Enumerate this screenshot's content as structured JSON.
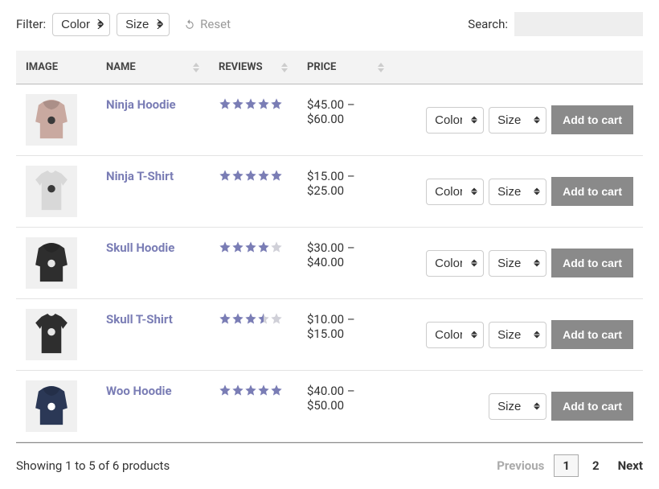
{
  "filter": {
    "label": "Filter:",
    "selects": [
      {
        "id": "color",
        "label": "Color"
      },
      {
        "id": "size",
        "label": "Size"
      }
    ],
    "reset": "Reset"
  },
  "search": {
    "label": "Search:"
  },
  "table": {
    "headers": {
      "image": "IMAGE",
      "name": "NAME",
      "reviews": "REVIEWS",
      "price": "PRICE"
    },
    "rows": [
      {
        "id": "ninja-hoodie",
        "name": "Ninja Hoodie",
        "rating": 5.0,
        "price": "$45.00 – $60.00",
        "variants": [
          "Color",
          "Size"
        ],
        "thumb": {
          "type": "hoodie",
          "body": "#c9a9a0",
          "print": "#3a3a3a"
        }
      },
      {
        "id": "ninja-tshirt",
        "name": "Ninja T-Shirt",
        "rating": 5.0,
        "price": "$15.00 – $25.00",
        "variants": [
          "Color",
          "Size"
        ],
        "thumb": {
          "type": "tshirt",
          "body": "#d8d8d8",
          "print": "#3a3a3a"
        }
      },
      {
        "id": "skull-hoodie",
        "name": "Skull Hoodie",
        "rating": 4.0,
        "price": "$30.00 – $40.00",
        "variants": [
          "Color",
          "Size"
        ],
        "thumb": {
          "type": "hoodie",
          "body": "#2e2e2e",
          "print": "#e6e6e6"
        }
      },
      {
        "id": "skull-tshirt",
        "name": "Skull T-Shirt",
        "rating": 3.5,
        "price": "$10.00 – $15.00",
        "variants": [
          "Color",
          "Size"
        ],
        "thumb": {
          "type": "tshirt",
          "body": "#2e2e2e",
          "print": "#e6e6e6"
        }
      },
      {
        "id": "woo-hoodie",
        "name": "Woo Hoodie",
        "rating": 5.0,
        "price": "$40.00 – $50.00",
        "variants": [
          "Size"
        ],
        "thumb": {
          "type": "hoodie",
          "body": "#2b3856",
          "print": "#ffffff"
        }
      }
    ],
    "add_label": "Add to cart"
  },
  "footer": {
    "summary": "Showing 1 to 5 of 6 products",
    "prev": "Previous",
    "next": "Next",
    "pages": [
      "1",
      "2"
    ],
    "current": 1
  }
}
